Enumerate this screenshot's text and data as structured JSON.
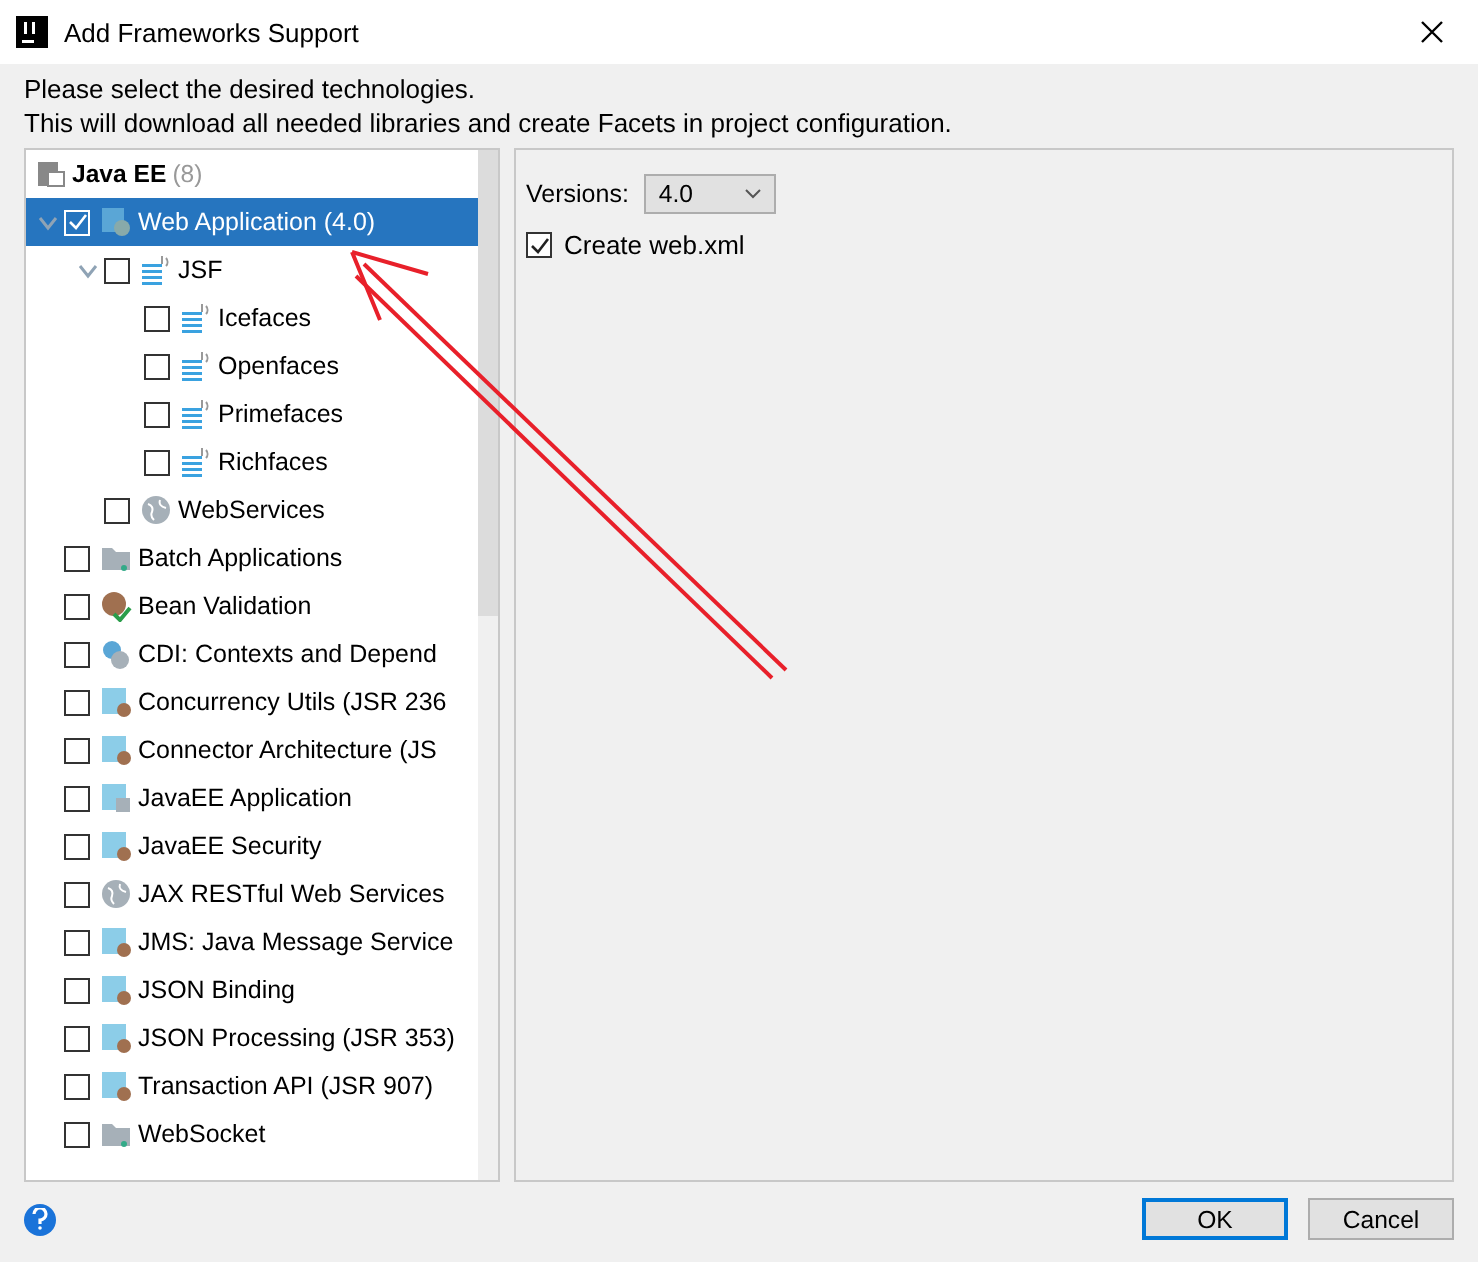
{
  "window": {
    "title": "Add Frameworks Support"
  },
  "description": [
    "Please select the desired technologies.",
    "This will download all needed libraries and create Facets in project configuration."
  ],
  "tree": {
    "group": {
      "label": "Java EE",
      "count": "(8)"
    },
    "items": [
      {
        "label": "Web Application (4.0)",
        "kind": "web",
        "checked": true,
        "selected": true,
        "expanded": true,
        "children": [
          {
            "label": "JSF",
            "kind": "jsf",
            "checked": false,
            "selected": false,
            "expanded": true,
            "children": [
              {
                "label": "Icefaces",
                "kind": "jsf",
                "checked": false,
                "selected": false
              },
              {
                "label": "Openfaces",
                "kind": "jsf",
                "checked": false,
                "selected": false
              },
              {
                "label": "Primefaces",
                "kind": "jsf",
                "checked": false,
                "selected": false
              },
              {
                "label": "Richfaces",
                "kind": "jsf",
                "checked": false,
                "selected": false
              }
            ]
          },
          {
            "label": "WebServices",
            "kind": "globe",
            "checked": false,
            "selected": false
          }
        ]
      },
      {
        "label": "Batch Applications",
        "kind": "batch",
        "checked": false,
        "selected": false
      },
      {
        "label": "Bean Validation",
        "kind": "bean",
        "checked": false,
        "selected": false
      },
      {
        "label": "CDI: Contexts and Depend",
        "kind": "cdi",
        "checked": false,
        "selected": false
      },
      {
        "label": "Concurrency Utils (JSR 236",
        "kind": "module",
        "checked": false,
        "selected": false
      },
      {
        "label": "Connector Architecture (JS",
        "kind": "module",
        "checked": false,
        "selected": false
      },
      {
        "label": "JavaEE Application",
        "kind": "app",
        "checked": false,
        "selected": false
      },
      {
        "label": "JavaEE Security",
        "kind": "module",
        "checked": false,
        "selected": false
      },
      {
        "label": "JAX RESTful Web Services",
        "kind": "globe",
        "checked": false,
        "selected": false
      },
      {
        "label": "JMS: Java Message Service",
        "kind": "module",
        "checked": false,
        "selected": false
      },
      {
        "label": "JSON Binding",
        "kind": "module",
        "checked": false,
        "selected": false
      },
      {
        "label": "JSON Processing (JSR 353)",
        "kind": "module",
        "checked": false,
        "selected": false
      },
      {
        "label": "Transaction API (JSR 907)",
        "kind": "module",
        "checked": false,
        "selected": false
      },
      {
        "label": "WebSocket",
        "kind": "batch",
        "checked": false,
        "selected": false
      }
    ]
  },
  "settings": {
    "versions_label": "Versions:",
    "version": "4.0",
    "create_web_xml": {
      "label": "Create web.xml",
      "checked": true
    }
  },
  "buttons": [
    {
      "label": "OK",
      "kind": "default"
    },
    {
      "label": "Cancel",
      "kind": "normal"
    }
  ]
}
